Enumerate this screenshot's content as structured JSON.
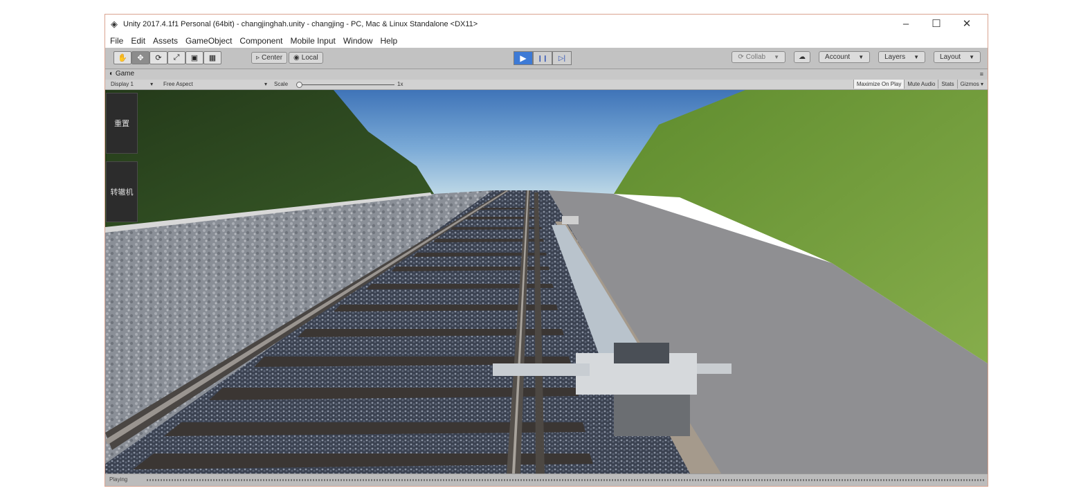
{
  "window": {
    "title": "Unity 2017.4.1f1 Personal (64bit) - changjinghah.unity - changjing - PC, Mac & Linux Standalone <DX11>",
    "controls": {
      "minimize": "–",
      "maximize": "☐",
      "close": "✕"
    }
  },
  "menu": [
    "File",
    "Edit",
    "Assets",
    "GameObject",
    "Component",
    "Mobile Input",
    "Window",
    "Help"
  ],
  "toolbar": {
    "transform_tools": [
      "hand-icon",
      "move-icon",
      "rotate-icon",
      "scale-icon",
      "rect-icon",
      "transform-icon"
    ],
    "pivot_label": "Center",
    "space_label": "Local",
    "play_icons": {
      "play": "▶",
      "pause": "❙❙",
      "step": "▷|"
    },
    "collab_label": "Collab",
    "cloud_icon": "cloud-icon",
    "account_label": "Account",
    "layers_label": "Layers",
    "layout_label": "Layout"
  },
  "game_tab": {
    "label": "Game",
    "display": "Display 1",
    "aspect": "Free Aspect",
    "scale_label": "Scale",
    "scale_value": "1x",
    "maximize_on_play": "Maximize On Play",
    "mute_audio": "Mute Audio",
    "stats": "Stats",
    "gizmos": "Gizmos"
  },
  "scene_buttons": [
    "重置",
    "转辙机"
  ],
  "status": {
    "text": "Playing"
  },
  "colors": {
    "play_active": "#3d7ad6",
    "sky_top": "#3f74b8",
    "grass": "#6f9a3c"
  }
}
